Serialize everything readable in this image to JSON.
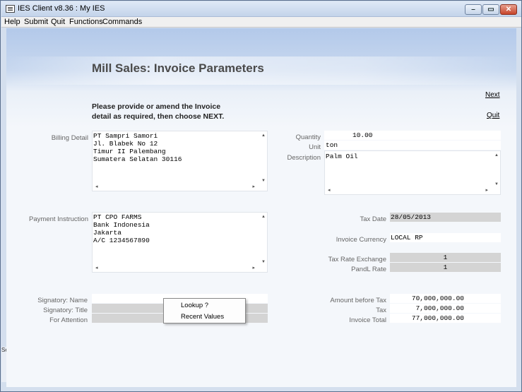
{
  "window": {
    "title": "IES Client v8.36 : My IES"
  },
  "window_controls": {
    "minimize": "–",
    "maximize": "▭",
    "close": "✕"
  },
  "menu": [
    "Help",
    "Submit",
    "Quit",
    "Functions",
    "Commands"
  ],
  "page": {
    "title": "Mill Sales: Invoice Parameters",
    "instruction_line1": "Please provide or amend the Invoice",
    "instruction_line2": "detail as required, then choose NEXT."
  },
  "links": {
    "next": "Next",
    "quit": "Quit"
  },
  "billing": {
    "label": "Billing Detail",
    "text": "PT Sampri Samori\nJl. Blabek No 12\nTimur II Palembang\nSumatera Selatan 30116"
  },
  "payment": {
    "label": "Payment Instruction",
    "text": "PT CPO FARMS\nBank Indonesia\nJakarta\nA/C 1234567890"
  },
  "quantity": {
    "label": "Quantity",
    "value": "10.00"
  },
  "unit": {
    "label": "Unit",
    "value": "ton"
  },
  "description": {
    "label": "Description",
    "text": "Palm Oil"
  },
  "tax_date": {
    "label": "Tax Date",
    "value": "28/05/2013"
  },
  "invoice_currency": {
    "label": "Invoice Currency",
    "value": "LOCAL RP"
  },
  "tax_rate_exchange": {
    "label": "Tax Rate Exchange",
    "value": "1"
  },
  "pandl_rate": {
    "label": "PandL Rate",
    "value": "1"
  },
  "signatory_name": {
    "label": "Signatory: Name",
    "value": ""
  },
  "signatory_title": {
    "label": "Signatory: Title",
    "value": ""
  },
  "for_attention": {
    "label": "For Attention",
    "value": ""
  },
  "amount_before_tax": {
    "label": "Amount before Tax",
    "value": "70,000,000.00"
  },
  "tax": {
    "label": "Tax",
    "value": "7,000,000.00"
  },
  "invoice_total": {
    "label": "Invoice Total",
    "value": "77,000,000.00"
  },
  "context_menu": {
    "lookup": "Lookup ?",
    "recent": "Recent Values"
  },
  "side_stub": {
    "text": "Ses"
  }
}
